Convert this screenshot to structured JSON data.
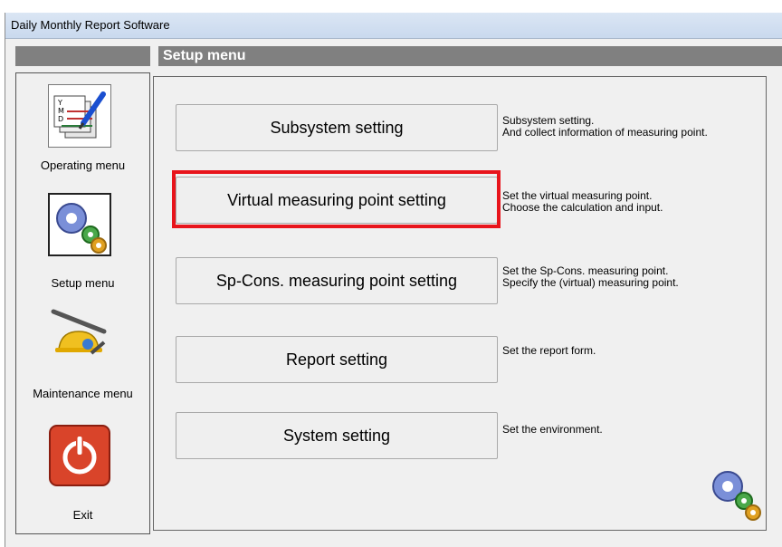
{
  "window": {
    "title": "Daily Monthly Report Software"
  },
  "header": {
    "heading": "Setup menu"
  },
  "sidebar": {
    "items": [
      {
        "label": "Operating menu",
        "icon": "calendar-edit-icon"
      },
      {
        "label": "Setup menu",
        "icon": "gears-icon",
        "selected": true
      },
      {
        "label": "Maintenance menu",
        "icon": "tools-helmet-icon"
      },
      {
        "label": "Exit",
        "icon": "power-icon"
      }
    ]
  },
  "main": {
    "buttons": [
      {
        "label": "Subsystem setting",
        "desc1": "Subsystem setting.",
        "desc2": "And collect information of measuring point."
      },
      {
        "label": "Virtual measuring point setting",
        "desc1": "Set the virtual measuring point.",
        "desc2": "Choose the calculation and input.",
        "highlighted": true
      },
      {
        "label": "Sp-Cons. measuring point setting",
        "desc1": "Set the Sp-Cons. measuring point.",
        "desc2": "Specify the (virtual) measuring point."
      },
      {
        "label": "Report setting",
        "desc1": "Set the report form.",
        "desc2": ""
      },
      {
        "label": "System setting",
        "desc1": "Set the environment.",
        "desc2": ""
      }
    ],
    "corner_icon": "gears-icon"
  },
  "colors": {
    "highlight": "#e8141b",
    "bar": "#808080",
    "exit": "#d9442a"
  }
}
